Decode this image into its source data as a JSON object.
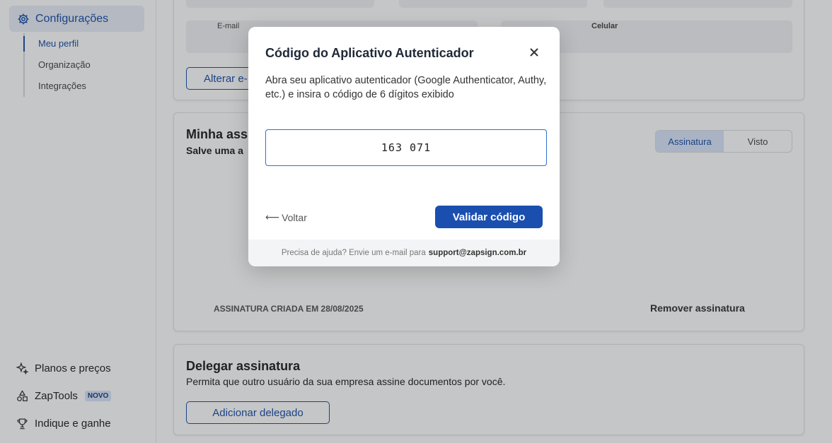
{
  "sidebar": {
    "settings_label": "Configurações",
    "sub_items": [
      {
        "label": "Meu perfil",
        "active": true
      },
      {
        "label": "Organização",
        "active": false
      },
      {
        "label": "Integrações",
        "active": false
      }
    ],
    "bottom_items": [
      {
        "label": "Planos e preços",
        "icon": "sparkle-icon"
      },
      {
        "label": "ZapTools",
        "icon": "shapes-icon",
        "badge": "NOVO"
      },
      {
        "label": "Indique e ganhe",
        "icon": "trophy-icon"
      }
    ]
  },
  "profile_card": {
    "email_label": "E-mail",
    "phone_label": "Celular",
    "change_email_button": "Alterar e-"
  },
  "signature_card": {
    "title": "Minha ass",
    "subtitle": "Salve uma a",
    "tabs": [
      "Assinatura",
      "Visto"
    ],
    "active_tab": "Assinatura",
    "created_text": "ASSINATURA CRIADA EM 28/08/2025",
    "remove_label": "Remover assinatura"
  },
  "delegate_card": {
    "title": "Delegar assinatura",
    "subtitle": "Permita que outro usuário da sua empresa assine documentos por você.",
    "add_button": "Adicionar delegado"
  },
  "modal": {
    "title": "Código do Aplicativo Autenticador",
    "description": "Abra seu aplicativo autenticador (Google Authenticator, Authy, etc.) e insira o código de 6 dígitos exibido",
    "code_value": "163 071",
    "back_label": "Voltar",
    "validate_label": "Validar código",
    "footer_text": "Precisa de ajuda? Envie um e-mail para",
    "footer_email": "support@zapsign.com.br"
  },
  "colors": {
    "primary": "#1a4fb0",
    "overlay": "rgba(30,34,40,0.26)"
  }
}
